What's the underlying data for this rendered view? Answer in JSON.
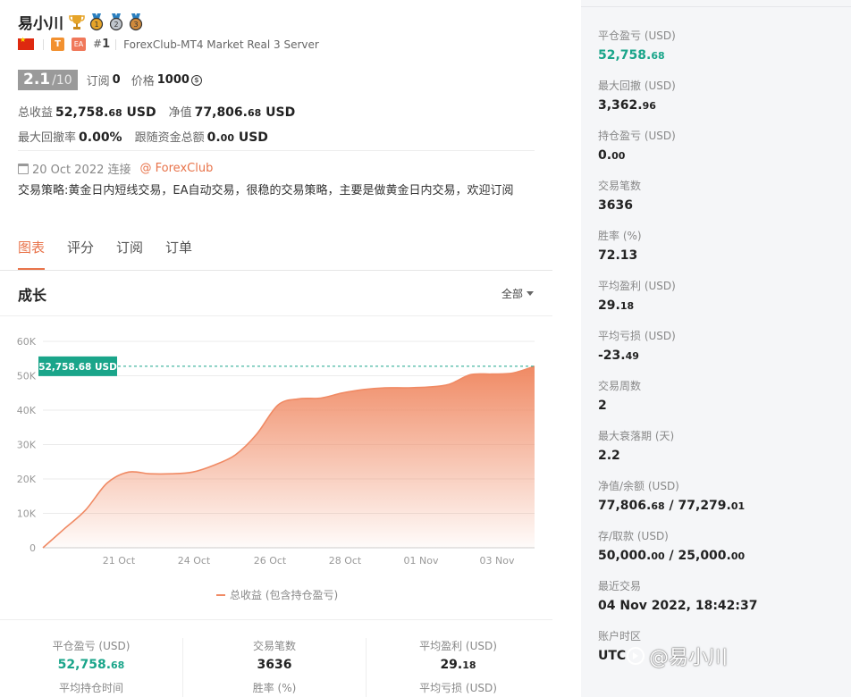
{
  "trader": {
    "name": "易小川",
    "rank_prefix": "#",
    "rank": "1",
    "badge_t": "T",
    "badge_ea": "EA",
    "server": "ForexClub-MT4 Market Real 3 Server"
  },
  "score": {
    "value": "2.1",
    "max": "/10",
    "subs_label": "订阅",
    "subs_value": "0",
    "price_label": "价格",
    "price_value": "1000",
    "coin_symbol": "$"
  },
  "stats": {
    "total_label": "总收益",
    "total_int": "52,758.",
    "total_dec": "68",
    "total_unit": " USD",
    "equity_label": "净值",
    "equity_int": "77,806.",
    "equity_dec": "68",
    "equity_unit": " USD",
    "drawdown_label": "最大回撤率",
    "drawdown_value": "0.00%",
    "follow_label": "跟随资金总额",
    "follow_int": "0.",
    "follow_dec": "00",
    "follow_unit": " USD"
  },
  "connection": {
    "date": "20 Oct 2022 连接",
    "broker": "@ ForexClub"
  },
  "description": "交易策略:黄金日内短线交易，EA自动交易，很稳的交易策略，主要是做黄金日内交易，欢迎订阅",
  "tabs": [
    {
      "label": "图表",
      "active": true
    },
    {
      "label": "评分",
      "active": false
    },
    {
      "label": "订阅",
      "active": false
    },
    {
      "label": "订单",
      "active": false
    }
  ],
  "growth": {
    "title": "成长",
    "filter": "全部"
  },
  "chart_data": {
    "type": "area",
    "title": "",
    "xlabel": "",
    "ylabel": "",
    "ylim": [
      0,
      60000
    ],
    "y_ticks": [
      "0",
      "10K",
      "20K",
      "30K",
      "40K",
      "50K",
      "60K"
    ],
    "x_ticks": [
      "21 Oct",
      "24 Oct",
      "26 Oct",
      "28 Oct",
      "01 Nov",
      "03 Nov"
    ],
    "series": [
      {
        "name": "总收益 (包含持仓盈亏)",
        "color": "#f08a64",
        "values": [
          0,
          5500,
          11000,
          18800,
          22000,
          21500,
          21500,
          22000,
          24000,
          27000,
          33000,
          41500,
          43300,
          43500,
          45000,
          46000,
          46500,
          46500,
          46700,
          47500,
          50300,
          50500,
          50800,
          52758.68
        ]
      }
    ],
    "current_label": "52,758.68 USD",
    "current_value": 52758.68,
    "grid": true,
    "legend": "bottom"
  },
  "bottom_stats": [
    {
      "label": "平仓盈亏 (USD)",
      "int": "52,758.",
      "dec": "68",
      "green": true,
      "label2": "平均持仓时间"
    },
    {
      "label": "交易笔数",
      "int": "3636",
      "dec": "",
      "green": false,
      "label2": "胜率 (%)"
    },
    {
      "label": "平均盈利 (USD)",
      "int": "29.",
      "dec": "18",
      "green": false,
      "label2": "平均亏损 (USD)"
    }
  ],
  "right_panel": [
    {
      "label": "平仓盈亏 (USD)",
      "int": "52,758.",
      "dec": "68",
      "green": true
    },
    {
      "label": "最大回撤 (USD)",
      "int": "3,362.",
      "dec": "96",
      "green": false
    },
    {
      "label": "持仓盈亏 (USD)",
      "int": "0.",
      "dec": "00",
      "green": false
    },
    {
      "label": "交易笔数",
      "int": "3636",
      "dec": "",
      "green": false
    },
    {
      "label": "胜率 (%)",
      "int": "72.13",
      "dec": "",
      "green": false
    },
    {
      "label": "平均盈利 (USD)",
      "int": "29.",
      "dec": "18",
      "green": false
    },
    {
      "label": "平均亏损 (USD)",
      "int": "-23.",
      "dec": "49",
      "green": false
    },
    {
      "label": "交易周数",
      "int": "2",
      "dec": "",
      "green": false
    },
    {
      "label": "最大衰落期 (天)",
      "int": "2.2",
      "dec": "",
      "green": false
    },
    {
      "label": "净值/余额 (USD)",
      "int": "77,806.",
      "dec": "68",
      "int2": " / 77,279.",
      "dec2": "01",
      "green": false
    },
    {
      "label": "存/取款 (USD)",
      "int": "50,000.",
      "dec": "00",
      "int2": " / 25,000.",
      "dec2": "00",
      "green": false
    },
    {
      "label": "最近交易",
      "int": "04 Nov 2022, 18:42:37",
      "dec": "",
      "green": false
    },
    {
      "label": "账户时区",
      "int": "UTC",
      "dec": "",
      "green": false
    }
  ],
  "watermark": "@易小川"
}
